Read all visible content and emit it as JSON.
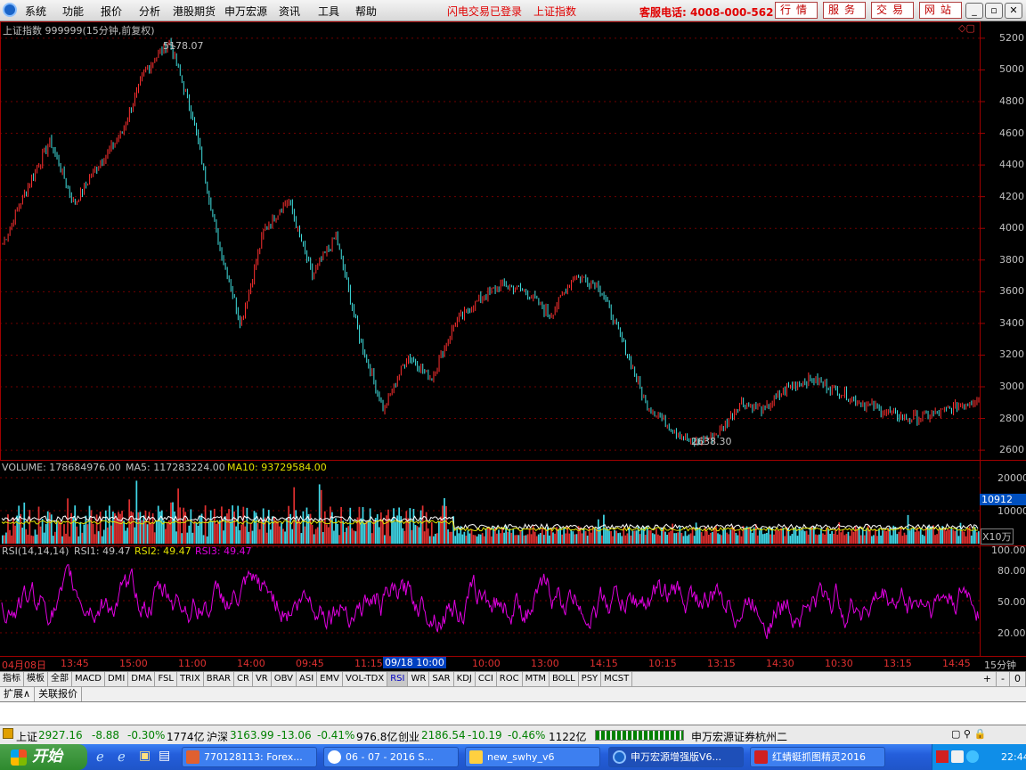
{
  "menu": {
    "items": [
      "系统",
      "功能",
      "报价",
      "分析",
      "港股期货",
      "申万宏源",
      "资讯",
      "工具",
      "帮助"
    ],
    "status1": "闪电交易已登录",
    "status2": "上证指数",
    "phone": "客服电话: 4008-000-562",
    "buttons": [
      "行情",
      "服务",
      "交易",
      "网站"
    ]
  },
  "chart": {
    "title": "上证指数 999999(15分钟,前复权)",
    "high_label": "5178.07",
    "low_label": "2638.30",
    "price_ticks": [
      "5200",
      "5000",
      "4800",
      "4600",
      "4400",
      "4200",
      "4000",
      "3800",
      "3600",
      "3400",
      "3200",
      "3000",
      "2800",
      "2600"
    ],
    "volume_label": "VOLUME: 178684976.00",
    "ma5_label": "MA5: 117283224.00",
    "ma10_label": "MA10: 93729584.00",
    "volume_ticks": [
      "20000",
      "10000"
    ],
    "volume_current": "10912",
    "volume_unit": "X10万",
    "rsi_label": "RSI(14,14,14)",
    "rsi1_label": "RSI1: 49.47",
    "rsi2_label": "RSI2: 49.47",
    "rsi3_label": "RSI3: 49.47",
    "rsi_ticks": [
      "100.00",
      "80.00",
      "50.00",
      "20.00"
    ],
    "time_labels": [
      "04月08日",
      "13:45",
      "15:00",
      "11:00",
      "14:00",
      "09:45",
      "11:15",
      "09/18 10:00",
      "10:00",
      "13:00",
      "14:15",
      "10:15",
      "13:15",
      "14:30",
      "10:30",
      "13:15",
      "14:45"
    ],
    "period": "15分钟"
  },
  "chart_data": {
    "type": "line",
    "title": "上证指数 999999(15分钟,前复权)",
    "ylim": [
      2550,
      5250
    ],
    "x": [
      "04月08日",
      "13:45",
      "15:00",
      "11:00",
      "14:00",
      "09:45",
      "11:15",
      "09/18 10:00",
      "10:00",
      "13:00",
      "14:15",
      "10:15",
      "13:15",
      "14:30",
      "10:30",
      "13:15",
      "14:45"
    ],
    "series": [
      {
        "values": [
          3900,
          4250,
          4550,
          4150,
          4400,
          4600,
          5000,
          5178,
          4700,
          3950,
          3400,
          4000,
          4180,
          3700,
          3950,
          3300,
          2850,
          3200,
          3050,
          3400,
          3550,
          3650,
          3600,
          3450,
          3700,
          3650,
          3300,
          2900,
          2750,
          2638,
          2700,
          2900,
          2850,
          3000,
          3050,
          2980,
          2900,
          2850,
          2800,
          2820,
          2870,
          2930
        ]
      }
    ],
    "high": 5178.07,
    "low": 2638.3
  },
  "tabs": [
    "指标",
    "模板",
    "全部",
    "MACD",
    "DMI",
    "DMA",
    "FSL",
    "TRIX",
    "BRAR",
    "CR",
    "VR",
    "OBV",
    "ASI",
    "EMV",
    "VOL-TDX",
    "RSI",
    "WR",
    "SAR",
    "KDJ",
    "CCI",
    "ROC",
    "MTM",
    "BOLL",
    "PSY",
    "MCST"
  ],
  "tabs_right": [
    "+",
    "-",
    "0"
  ],
  "subtabs": [
    "扩展∧",
    "关联报价"
  ],
  "status": {
    "sh_name": "上证",
    "sh_val": "2927.16",
    "sh_chg": "-8.88",
    "sh_pct": "-0.30%",
    "sh_amt": "1774亿",
    "hs_name": "沪深",
    "hs_val": "3163.99",
    "hs_chg": "-13.06",
    "hs_pct": "-0.41%",
    "hs_amt": "976.8亿",
    "cy_name": "创业",
    "cy_val": "2186.54",
    "cy_chg": "-10.19",
    "cy_pct": "-0.46%",
    "cy_amt": "1122亿",
    "broker": "申万宏源证券杭州二"
  },
  "taskbar": {
    "start": "开始",
    "tasks": [
      "770128113: Forex...",
      "06 - 07 - 2016 S...",
      "new_swhy_v6",
      "申万宏源增强版V6...",
      "红蜻蜓抓图精灵2016"
    ],
    "time": "22:44"
  }
}
